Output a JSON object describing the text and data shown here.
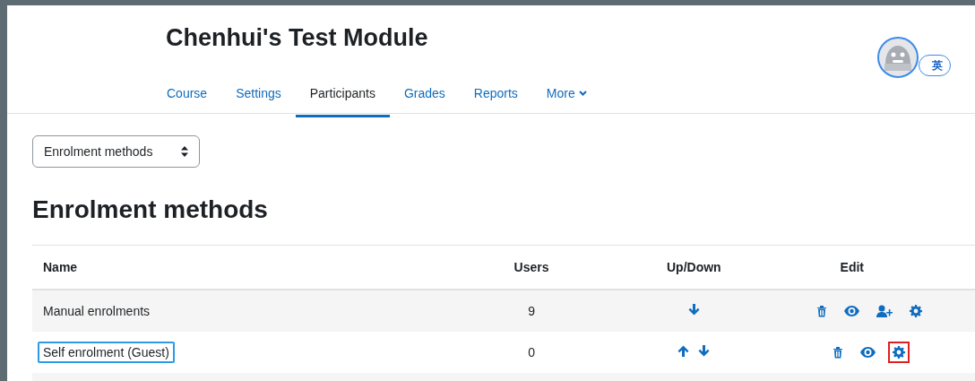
{
  "course_title": "Chenhui's Test Module",
  "tabs": [
    {
      "label": "Course",
      "selected": false,
      "dropdown": false
    },
    {
      "label": "Settings",
      "selected": false,
      "dropdown": false
    },
    {
      "label": "Participants",
      "selected": true,
      "dropdown": false
    },
    {
      "label": "Grades",
      "selected": false,
      "dropdown": false
    },
    {
      "label": "Reports",
      "selected": false,
      "dropdown": false
    },
    {
      "label": "More",
      "selected": false,
      "dropdown": true
    }
  ],
  "user_badge": "英",
  "page_select": {
    "value": "Enrolment methods"
  },
  "heading": "Enrolment methods",
  "table": {
    "columns": [
      "Name",
      "Users",
      "Up/Down",
      "Edit"
    ],
    "rows": [
      {
        "name": "Manual enrolments",
        "highlighted": false,
        "users": "9",
        "up": false,
        "down": true,
        "actions": [
          {
            "kind": "delete",
            "highlighted": false
          },
          {
            "kind": "hide",
            "highlighted": false
          },
          {
            "kind": "enrol",
            "highlighted": false
          },
          {
            "kind": "settings",
            "highlighted": false
          }
        ]
      },
      {
        "name": "Self enrolment (Guest)",
        "highlighted": true,
        "users": "0",
        "up": true,
        "down": true,
        "actions": [
          {
            "kind": "delete",
            "highlighted": false
          },
          {
            "kind": "hide",
            "highlighted": false
          },
          {
            "kind": "settings",
            "highlighted": true
          }
        ]
      }
    ]
  }
}
